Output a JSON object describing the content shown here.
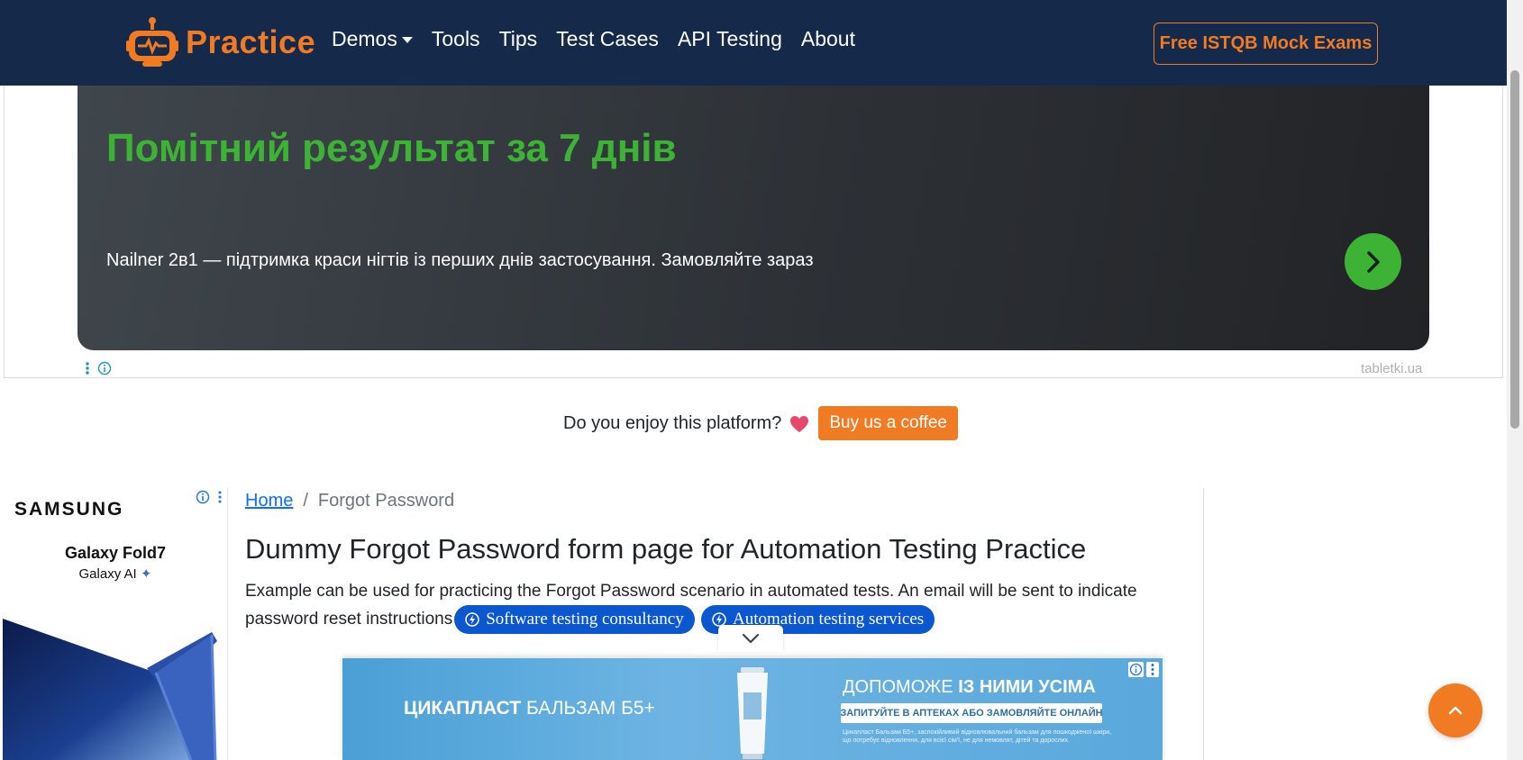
{
  "navbar": {
    "brand": "Practice",
    "links": [
      {
        "label": "Demos",
        "has_dropdown": true
      },
      {
        "label": "Tools"
      },
      {
        "label": "Tips"
      },
      {
        "label": "Test Cases"
      },
      {
        "label": "API Testing"
      },
      {
        "label": "About"
      }
    ],
    "cta": "Free ISTQB Mock Exams",
    "colors": {
      "background": "#15294a",
      "accent": "#f07b23"
    }
  },
  "top_ad": {
    "headline": "Помітний результат за 7 днів",
    "subtext": "Nailner 2в1 — підтримка краси нігтів із перших днів застосування. Замовляйте зараз",
    "source": "tabletki.ua",
    "go_icon": "chevron-right-icon",
    "colors": {
      "headline": "#3db336",
      "button": "#3db336"
    }
  },
  "donate": {
    "text": "Do you enjoy this platform?",
    "heart_icon": "heart-icon",
    "button": "Buy us a coffee"
  },
  "left_ad": {
    "brand": "SAMSUNG",
    "title": "Galaxy Fold7",
    "subtitle": "Galaxy AI"
  },
  "breadcrumb": {
    "home": "Home",
    "separator": "/",
    "current": "Forgot Password"
  },
  "main": {
    "title": "Dummy Forgot Password form page for Automation Testing Practice",
    "description": "Example can be used for practicing the Forgot Password scenario in automated tests. An email will be sent to indicate password reset instructions",
    "chips": [
      {
        "label": "Software testing consultancy",
        "icon": "bolt-icon"
      },
      {
        "label": "Automation testing services",
        "icon": "bolt-icon"
      }
    ]
  },
  "bottom_ad": {
    "brand_bold": "ЦИКАПЛАСТ",
    "brand_rest": "БАЛЬЗАМ Б5+",
    "headline_pre": "ДОПОМОЖЕ",
    "headline_bold": "ІЗ НИМИ УСІМА",
    "pill": "ЗАПИТУЙТЕ В АПТЕКАХ АБО ЗАМОВЛЯЙТЕ ОНЛАЙН",
    "fine": "Цикапласт Бальзам Б5+, заспокійливий відновлювальний бальзам для пошкодженої шкіри, що потребує відновлення, для всієї сім'ї, не для немовлят, дітей та дорослих."
  },
  "back_to_top_icon": "chevron-up-icon"
}
